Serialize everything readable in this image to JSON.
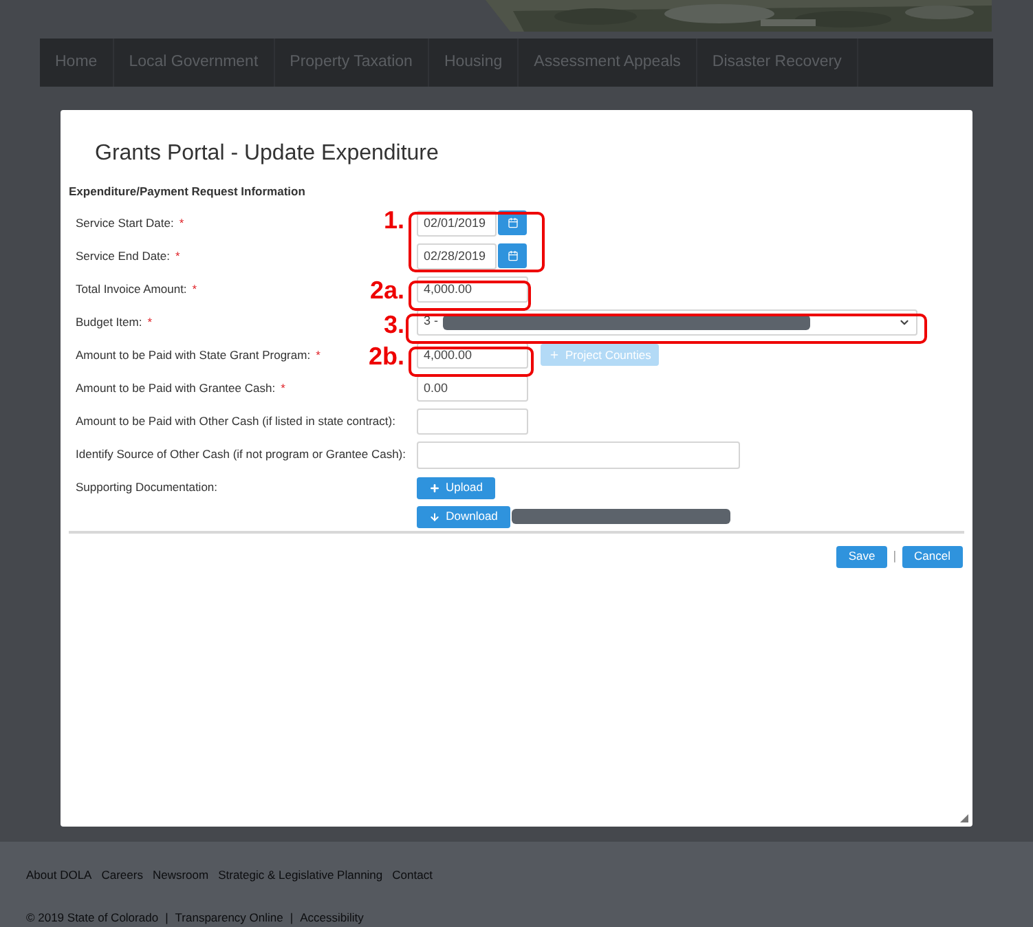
{
  "nav": {
    "items": [
      "Home",
      "Local Government",
      "Property Taxation",
      "Housing",
      "Assessment Appeals",
      "Disaster Recovery"
    ]
  },
  "modal": {
    "title": "Grants Portal - Update Expenditure",
    "section_title": "Expenditure/Payment Request Information",
    "fields": [
      {
        "kind": "date",
        "label": "Service Start Date:",
        "required": true,
        "value": "02/01/2019"
      },
      {
        "kind": "date",
        "label": "Service End Date:",
        "required": true,
        "value": "02/28/2019"
      },
      {
        "kind": "amount",
        "label": "Total Invoice Amount:",
        "required": true,
        "value": "4,000.00"
      },
      {
        "kind": "select",
        "label": "Budget Item:",
        "required": true,
        "value": "3 -"
      },
      {
        "kind": "amount",
        "label": "Amount to be Paid with State Grant Program:",
        "required": true,
        "value": "4,000.00",
        "extra_button": {
          "label": "Project Counties",
          "disabled": true
        }
      },
      {
        "kind": "amount",
        "label": "Amount to be Paid with Grantee Cash:",
        "required": true,
        "value": "0.00"
      },
      {
        "kind": "amount",
        "label": "Amount to be Paid with Other Cash (if listed in state contract):",
        "required": false
      },
      {
        "kind": "wide",
        "label": "Identify Source of Other Cash (if not program or Grantee Cash):",
        "required": false
      },
      {
        "kind": "upload",
        "label": "Supporting Documentation:",
        "required": false,
        "upload_label": "Upload",
        "download_label": "Download"
      }
    ],
    "buttons": [
      "Save",
      "Cancel"
    ],
    "separator": "|",
    "required_mark": "*"
  },
  "annotations": [
    {
      "label": "1."
    },
    {
      "label": "2a."
    },
    {
      "label": "3."
    },
    {
      "label": "2b."
    }
  ],
  "footer": {
    "links": [
      "About DOLA",
      "Careers",
      "Newsroom",
      "Strategic & Legislative Planning",
      "Contact"
    ],
    "bottom": [
      "© 2019 State of Colorado",
      "|",
      "Transparency Online",
      "|",
      "Accessibility"
    ]
  }
}
